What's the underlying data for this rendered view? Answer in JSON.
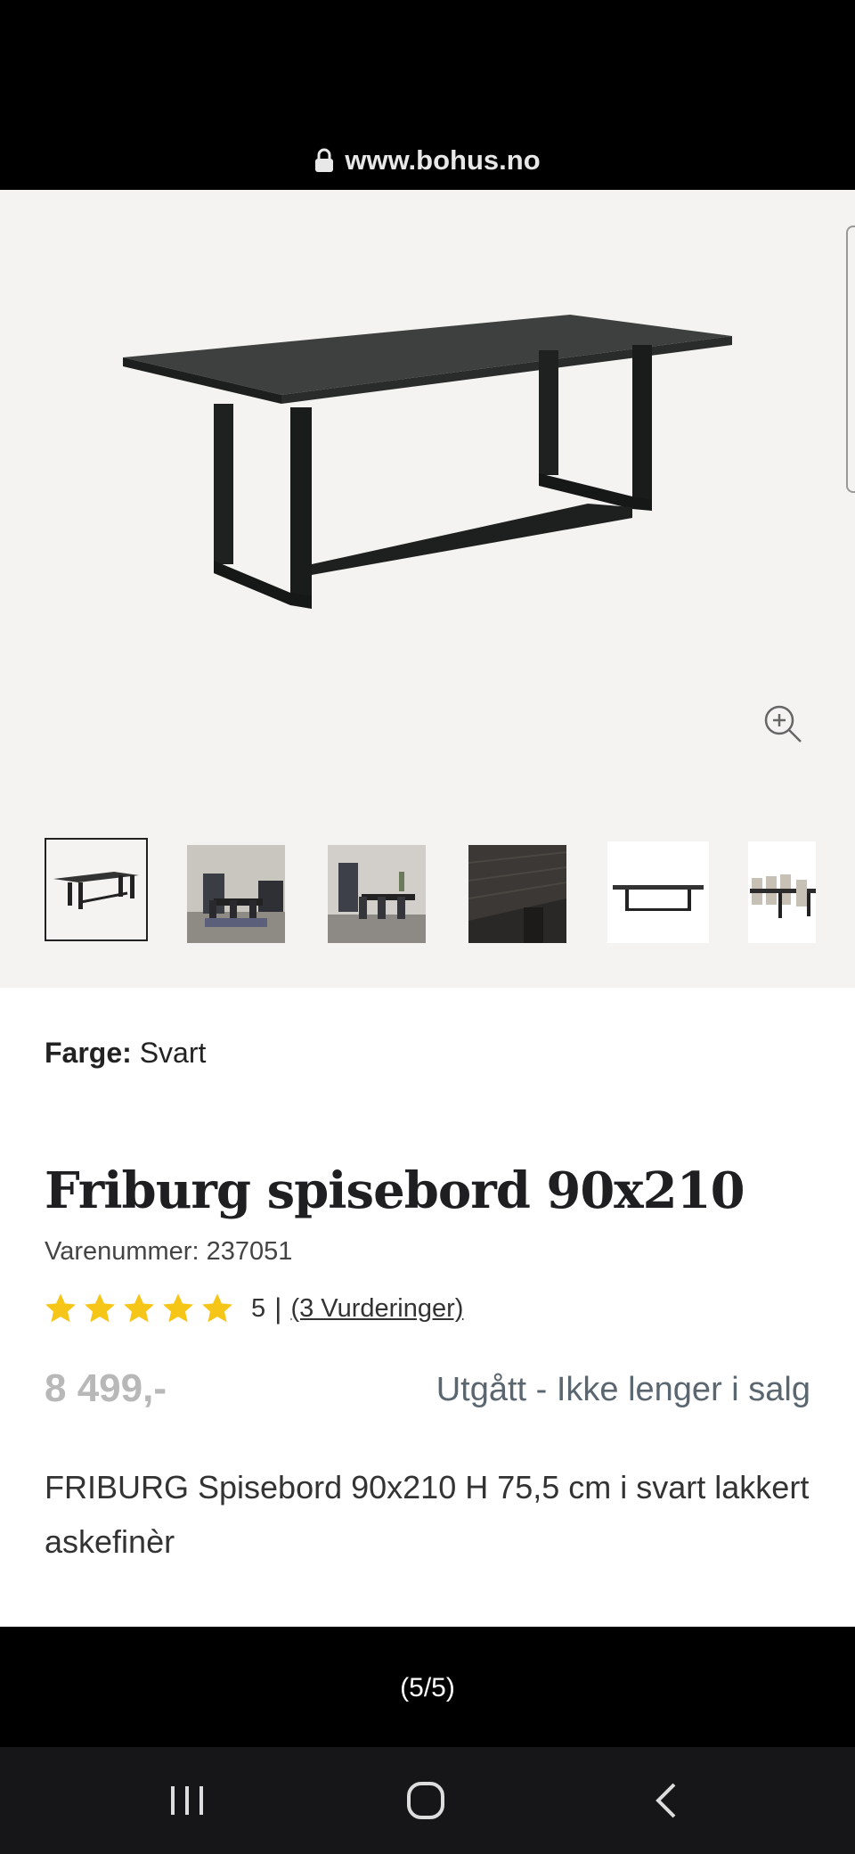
{
  "browser": {
    "url": "www.bohus.no"
  },
  "product": {
    "color_label": "Farge:",
    "color_value": "Svart",
    "title": "Friburg spisebord 90x210",
    "sku_text": "Varenummer: 237051",
    "rating_value": "5",
    "rating_separator": "|",
    "rating_link": "(3 Vurderinger)",
    "stars": 5,
    "price": "8 499,-",
    "status": "Utgått - Ikke lenger i salg",
    "description": "FRIBURG Spisebord 90x210 H 75,5 cm i svart lakkert askefinèr"
  },
  "gallery": {
    "counter": "(5/5)",
    "thumbnails": [
      "table-black",
      "dining-room-1",
      "dining-room-2",
      "wood-closeup",
      "table-side",
      "table-with-chairs"
    ]
  },
  "colors": {
    "star": "#f5c518",
    "status_text": "#5a6670",
    "price_text": "#b8b8b8",
    "gallery_bg": "#f4f3f1"
  },
  "icons": {
    "lock": "lock-icon",
    "zoom": "zoom-in-icon",
    "recent": "recent-apps-icon",
    "home": "home-icon",
    "back": "back-icon"
  }
}
